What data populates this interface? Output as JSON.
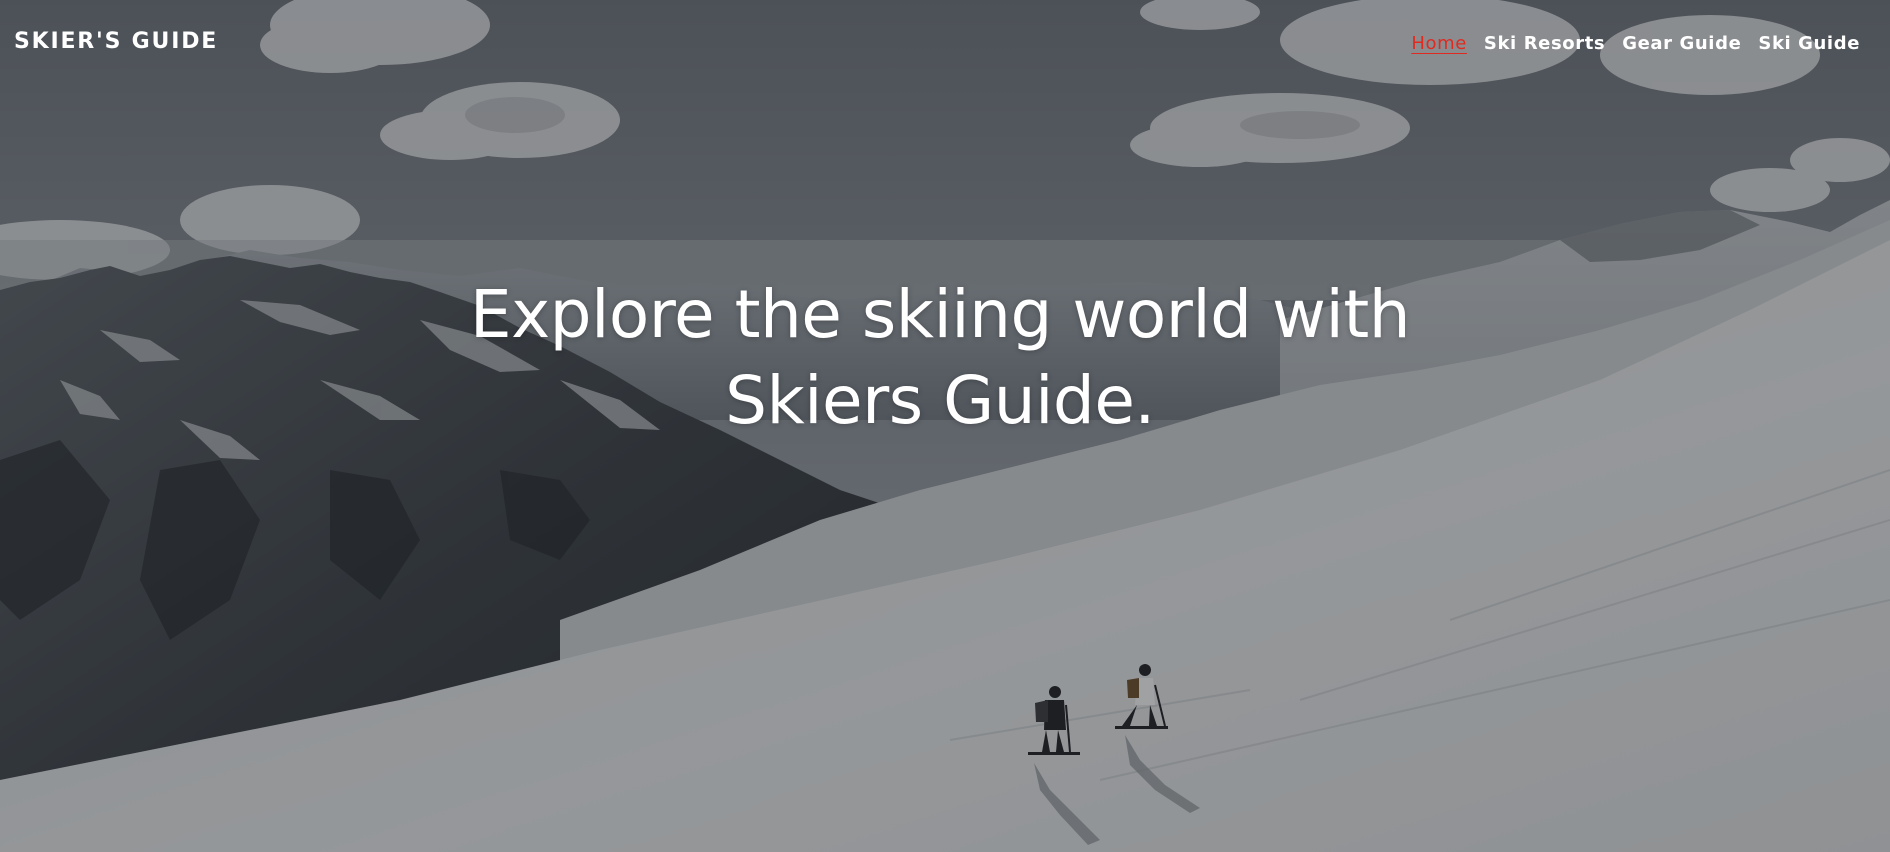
{
  "brand": {
    "name": "SKIER'S GUIDE"
  },
  "nav": {
    "items": [
      {
        "label": "Home",
        "active": true
      },
      {
        "label": "Ski Resorts",
        "active": false
      },
      {
        "label": "Gear Guide",
        "active": false
      },
      {
        "label": "Ski Guide",
        "active": false
      }
    ]
  },
  "hero": {
    "headline_line1": "Explore the skiing world with",
    "headline_line2": "Skiers Guide."
  },
  "colors": {
    "active_link": "#e02a20",
    "text": "#ffffff"
  }
}
